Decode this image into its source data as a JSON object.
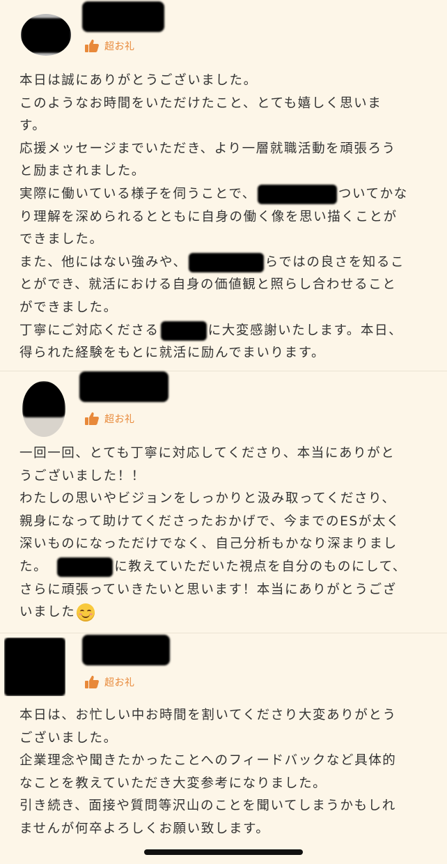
{
  "reviews": [
    {
      "badge_label": "超お礼",
      "lines": [
        "本日は誠にありがとうございました。",
        "このようなお時間をいただけたこと、とても嬉しく思いま",
        "す。",
        "応援メッセージまでいただき、より一層就職活動を頑張ろう",
        "と励まされました。"
      ],
      "line6_pre": "実際に働いている様子を伺うことで、",
      "line6_post": "ついてかな",
      "line7": "り理解を深められるとともに自身の働く像を思い描くことが",
      "line8": "できました。",
      "line9_pre": "また、他にはない強みや、",
      "line9_post": "らではの良さを知るこ",
      "line10": "とができ、就活における自身の価値観と照らし合わせること",
      "line11": "ができました。",
      "line12_pre": "丁寧にご対応くださる",
      "line12_post": "に大変感謝いたします。本日、",
      "line13": "得られた経験をもとに就活に励んでまいります。"
    },
    {
      "badge_label": "超お礼",
      "lines": [
        "一回一回、とても丁寧に対応してくださり、本当にありがと",
        "うございました！！",
        "わたしの思いやビジョンをしっかりと汲み取ってくださり、",
        "親身になって助けてくださったおかげで、今までのESが太く",
        "深いものになっただけでなく、自己分析もかなり深まりまし"
      ],
      "line6_pre": "た。",
      "line6_post": "に教えていただいた視点を自分のものにして、",
      "line7": "さらに頑張っていきたいと思います！本当にありがとうござ",
      "line8": "いました",
      "emoji": "smiling-face"
    },
    {
      "badge_label": "超お礼",
      "lines": [
        "本日は、お忙しい中お時間を割いてくださり大変ありがとう",
        "ございました。",
        "企業理念や聞きたかったことへのフィードバックなど具体的",
        "なことを教えていただき大変参考になりました。",
        "引き続き、面接や質問等沢山のことを聞いてしまうかもしれ",
        "ませんが何卒よろしくお願い致します。"
      ]
    }
  ],
  "icons": {
    "badge": "thumbs-up-icon"
  },
  "colors": {
    "background": "#fdf6e8",
    "badge": "#e8893a",
    "text": "#333333"
  }
}
